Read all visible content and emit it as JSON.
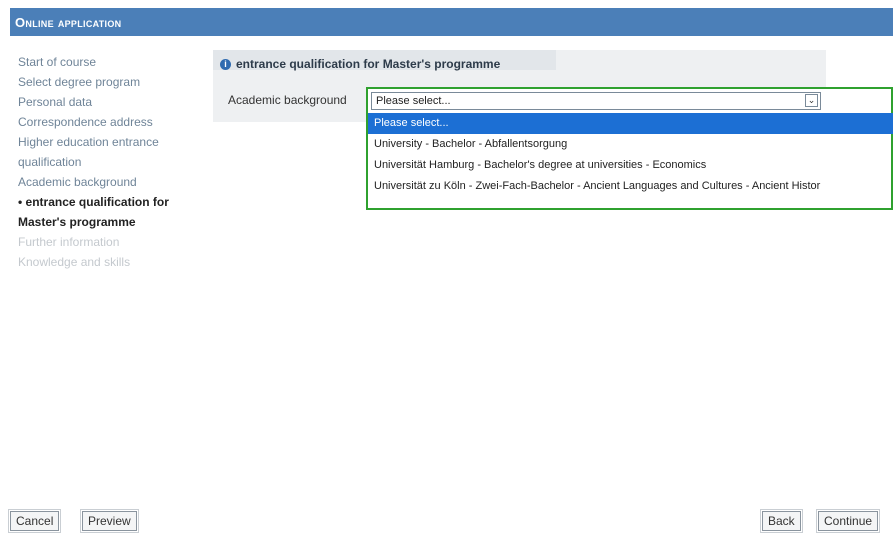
{
  "header": {
    "title": "Online application"
  },
  "sidebar": {
    "items": [
      {
        "label": "Start of course"
      },
      {
        "label": "Select degree program"
      },
      {
        "label": "Personal data"
      },
      {
        "label": "Correspondence address"
      },
      {
        "label": "Higher education entrance qualification"
      },
      {
        "label": "Academic background"
      },
      {
        "label": "entrance qualification for Master's programme"
      },
      {
        "label": "Further information"
      },
      {
        "label": "Knowledge and skills"
      }
    ]
  },
  "panel": {
    "title": "entrance qualification for Master's programme",
    "field_label": "Academic background",
    "select_value": "Please select...",
    "options": [
      "Please select...",
      "University - Bachelor - Abfallentsorgung",
      "Universität Hamburg - Bachelor's degree at universities - Economics",
      "Universität zu Köln - Zwei-Fach-Bachelor - Ancient Languages and Cultures - Ancient Histor"
    ]
  },
  "footer": {
    "cancel_label": "Cancel",
    "preview_label": "Preview",
    "back_label": "Back",
    "continue_label": "Continue"
  },
  "colors": {
    "header_bg": "#4b7fb8",
    "highlight_border": "#2fa12f",
    "selected_option": "#1c6fd4"
  }
}
